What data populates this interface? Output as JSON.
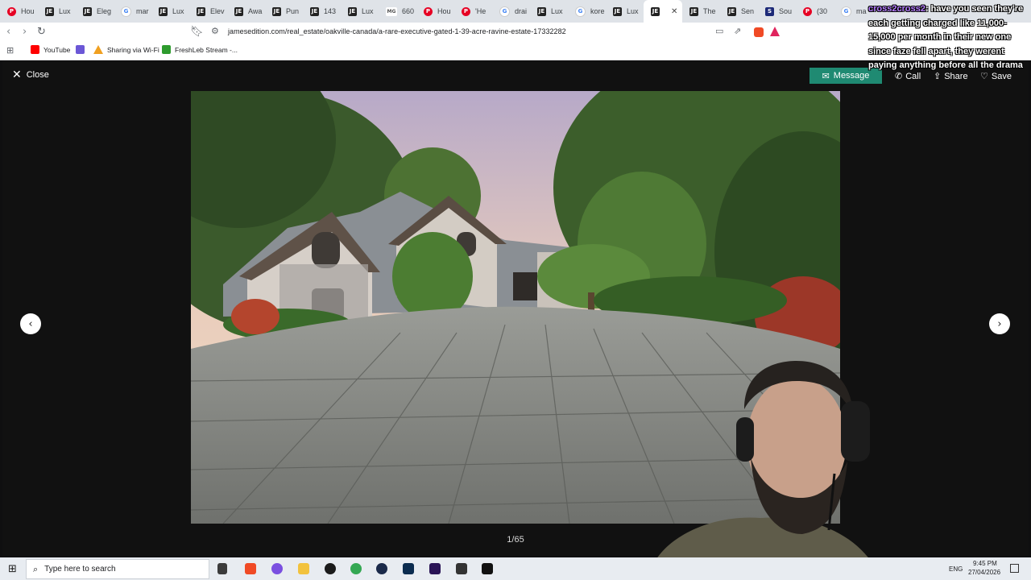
{
  "tabs": [
    {
      "label": "Hou",
      "icon": "pinterest-icon"
    },
    {
      "label": "Lux",
      "icon": "jamesedition-icon"
    },
    {
      "label": "Eleg",
      "icon": "jamesedition-icon"
    },
    {
      "label": "mar",
      "icon": "google-icon"
    },
    {
      "label": "Lux",
      "icon": "jamesedition-icon"
    },
    {
      "label": "Elev",
      "icon": "jamesedition-icon"
    },
    {
      "label": "Awa",
      "icon": "jamesedition-icon"
    },
    {
      "label": "Pun",
      "icon": "jamesedition-icon"
    },
    {
      "label": "143",
      "icon": "jamesedition-icon"
    },
    {
      "label": "Lux",
      "icon": "jamesedition-icon"
    },
    {
      "label": "660",
      "icon": "mg-icon"
    },
    {
      "label": "Hou",
      "icon": "pinterest-icon"
    },
    {
      "label": "'He",
      "icon": "pinterest-icon"
    },
    {
      "label": "drai",
      "icon": "google-icon"
    },
    {
      "label": "Lux",
      "icon": "jamesedition-icon"
    },
    {
      "label": "kore",
      "icon": "google-icon"
    },
    {
      "label": "Lux",
      "icon": "jamesedition-icon"
    },
    {
      "label": "",
      "icon": "jamesedition-icon",
      "active": true
    },
    {
      "label": "The",
      "icon": "jamesedition-icon"
    },
    {
      "label": "Sen",
      "icon": "jamesedition-icon"
    },
    {
      "label": "Sou",
      "icon": "sotheby-icon"
    },
    {
      "label": "(30",
      "icon": "pinterest-icon"
    },
    {
      "label": "ma",
      "icon": "google-icon"
    }
  ],
  "address": {
    "url": "jamesedition.com/real_estate/oakville-canada/a-rare-executive-gated-1-39-acre-ravine-estate-17332282"
  },
  "bookmarks": [
    {
      "label": "YouTube",
      "color": "#ff0000"
    },
    {
      "label": "",
      "color": "#6b57d6"
    },
    {
      "label": "Sharing via Wi-Fi",
      "color": "#f0a020"
    },
    {
      "label": "FreshLeb Stream -...",
      "color": "#2e9b2e"
    }
  ],
  "viewer": {
    "close_label": "Close",
    "message_label": "Message",
    "call_label": "Call",
    "share_label": "Share",
    "save_label": "Save",
    "counter": "1/65"
  },
  "chat": {
    "user": "cross2cross2",
    "message": ": have you seen they're each getting charged like 11,000-15,000 per month in their new one since faze fell apart, they werent paying anything before all the drama"
  },
  "taskbar": {
    "search_placeholder": "Type here to search",
    "language": "ENG",
    "time": "9:45 PM",
    "date": "27/04/2026"
  }
}
